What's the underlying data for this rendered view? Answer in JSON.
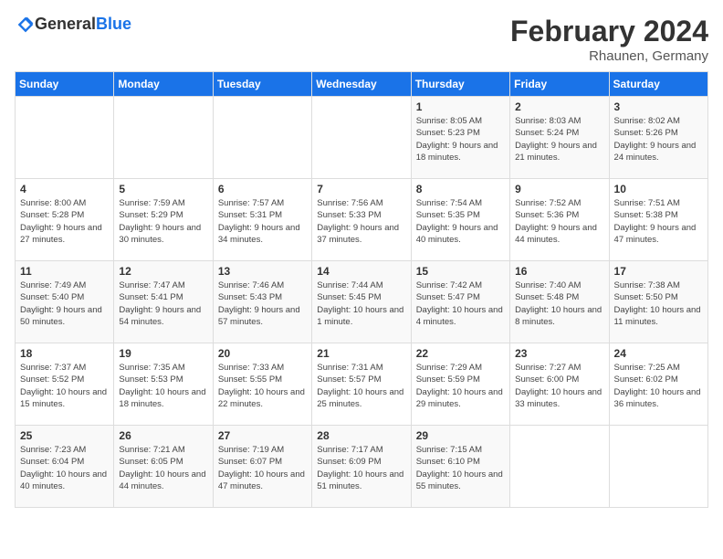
{
  "logo": {
    "text_general": "General",
    "text_blue": "Blue"
  },
  "title": "February 2024",
  "subtitle": "Rhaunen, Germany",
  "days_of_week": [
    "Sunday",
    "Monday",
    "Tuesday",
    "Wednesday",
    "Thursday",
    "Friday",
    "Saturday"
  ],
  "weeks": [
    [
      {
        "day": "",
        "info": ""
      },
      {
        "day": "",
        "info": ""
      },
      {
        "day": "",
        "info": ""
      },
      {
        "day": "",
        "info": ""
      },
      {
        "day": "1",
        "info": "Sunrise: 8:05 AM\nSunset: 5:23 PM\nDaylight: 9 hours\nand 18 minutes."
      },
      {
        "day": "2",
        "info": "Sunrise: 8:03 AM\nSunset: 5:24 PM\nDaylight: 9 hours\nand 21 minutes."
      },
      {
        "day": "3",
        "info": "Sunrise: 8:02 AM\nSunset: 5:26 PM\nDaylight: 9 hours\nand 24 minutes."
      }
    ],
    [
      {
        "day": "4",
        "info": "Sunrise: 8:00 AM\nSunset: 5:28 PM\nDaylight: 9 hours\nand 27 minutes."
      },
      {
        "day": "5",
        "info": "Sunrise: 7:59 AM\nSunset: 5:29 PM\nDaylight: 9 hours\nand 30 minutes."
      },
      {
        "day": "6",
        "info": "Sunrise: 7:57 AM\nSunset: 5:31 PM\nDaylight: 9 hours\nand 34 minutes."
      },
      {
        "day": "7",
        "info": "Sunrise: 7:56 AM\nSunset: 5:33 PM\nDaylight: 9 hours\nand 37 minutes."
      },
      {
        "day": "8",
        "info": "Sunrise: 7:54 AM\nSunset: 5:35 PM\nDaylight: 9 hours\nand 40 minutes."
      },
      {
        "day": "9",
        "info": "Sunrise: 7:52 AM\nSunset: 5:36 PM\nDaylight: 9 hours\nand 44 minutes."
      },
      {
        "day": "10",
        "info": "Sunrise: 7:51 AM\nSunset: 5:38 PM\nDaylight: 9 hours\nand 47 minutes."
      }
    ],
    [
      {
        "day": "11",
        "info": "Sunrise: 7:49 AM\nSunset: 5:40 PM\nDaylight: 9 hours\nand 50 minutes."
      },
      {
        "day": "12",
        "info": "Sunrise: 7:47 AM\nSunset: 5:41 PM\nDaylight: 9 hours\nand 54 minutes."
      },
      {
        "day": "13",
        "info": "Sunrise: 7:46 AM\nSunset: 5:43 PM\nDaylight: 9 hours\nand 57 minutes."
      },
      {
        "day": "14",
        "info": "Sunrise: 7:44 AM\nSunset: 5:45 PM\nDaylight: 10 hours\nand 1 minute."
      },
      {
        "day": "15",
        "info": "Sunrise: 7:42 AM\nSunset: 5:47 PM\nDaylight: 10 hours\nand 4 minutes."
      },
      {
        "day": "16",
        "info": "Sunrise: 7:40 AM\nSunset: 5:48 PM\nDaylight: 10 hours\nand 8 minutes."
      },
      {
        "day": "17",
        "info": "Sunrise: 7:38 AM\nSunset: 5:50 PM\nDaylight: 10 hours\nand 11 minutes."
      }
    ],
    [
      {
        "day": "18",
        "info": "Sunrise: 7:37 AM\nSunset: 5:52 PM\nDaylight: 10 hours\nand 15 minutes."
      },
      {
        "day": "19",
        "info": "Sunrise: 7:35 AM\nSunset: 5:53 PM\nDaylight: 10 hours\nand 18 minutes."
      },
      {
        "day": "20",
        "info": "Sunrise: 7:33 AM\nSunset: 5:55 PM\nDaylight: 10 hours\nand 22 minutes."
      },
      {
        "day": "21",
        "info": "Sunrise: 7:31 AM\nSunset: 5:57 PM\nDaylight: 10 hours\nand 25 minutes."
      },
      {
        "day": "22",
        "info": "Sunrise: 7:29 AM\nSunset: 5:59 PM\nDaylight: 10 hours\nand 29 minutes."
      },
      {
        "day": "23",
        "info": "Sunrise: 7:27 AM\nSunset: 6:00 PM\nDaylight: 10 hours\nand 33 minutes."
      },
      {
        "day": "24",
        "info": "Sunrise: 7:25 AM\nSunset: 6:02 PM\nDaylight: 10 hours\nand 36 minutes."
      }
    ],
    [
      {
        "day": "25",
        "info": "Sunrise: 7:23 AM\nSunset: 6:04 PM\nDaylight: 10 hours\nand 40 minutes."
      },
      {
        "day": "26",
        "info": "Sunrise: 7:21 AM\nSunset: 6:05 PM\nDaylight: 10 hours\nand 44 minutes."
      },
      {
        "day": "27",
        "info": "Sunrise: 7:19 AM\nSunset: 6:07 PM\nDaylight: 10 hours\nand 47 minutes."
      },
      {
        "day": "28",
        "info": "Sunrise: 7:17 AM\nSunset: 6:09 PM\nDaylight: 10 hours\nand 51 minutes."
      },
      {
        "day": "29",
        "info": "Sunrise: 7:15 AM\nSunset: 6:10 PM\nDaylight: 10 hours\nand 55 minutes."
      },
      {
        "day": "",
        "info": ""
      },
      {
        "day": "",
        "info": ""
      }
    ]
  ]
}
